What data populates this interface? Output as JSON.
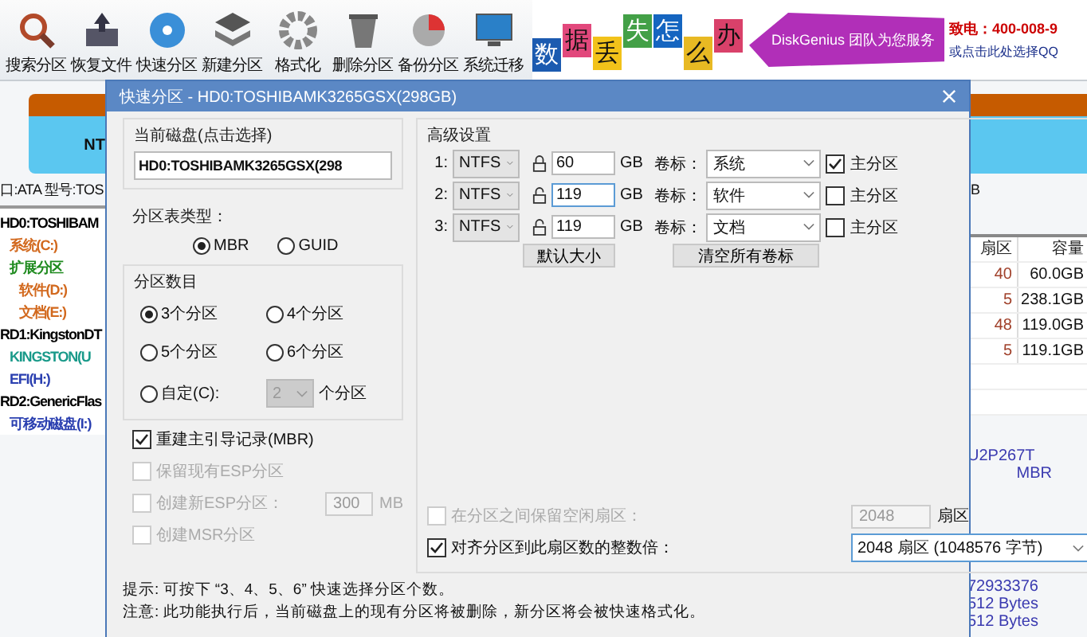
{
  "toolbar": [
    {
      "label": "搜索分区"
    },
    {
      "label": "恢复文件"
    },
    {
      "label": "快速分区"
    },
    {
      "label": "新建分区"
    },
    {
      "label": "格式化"
    },
    {
      "label": "删除分区"
    },
    {
      "label": "备份分区"
    },
    {
      "label": "系统迁移"
    }
  ],
  "banner": {
    "tiles": [
      {
        "text": "数",
        "color": "#1c5bb0"
      },
      {
        "text": "据",
        "color": "#e2487c"
      },
      {
        "text": "丢",
        "color": "#f2c21a"
      },
      {
        "text": "失",
        "color": "#43a047"
      },
      {
        "text": "怎",
        "color": "#1565c0"
      },
      {
        "text": "么",
        "color": "#e8b923"
      },
      {
        "text": "办",
        "color": "#d9416a"
      }
    ],
    "slogan": "DiskGenius 团队为您服务",
    "phone": "致电：400-008-9",
    "qq": "或点击此处选择QQ"
  },
  "disk_map": {
    "label": "NT"
  },
  "disk_info": {
    "left": "口:ATA  型号:TOS",
    "right": "B"
  },
  "tree": [
    {
      "label": "HD0:TOSHIBAM",
      "color": "#000000",
      "children": [
        {
          "label": "系统(C:)",
          "color": "#d2691e"
        },
        {
          "label": "扩展分区",
          "color": "#1e8a1e",
          "children": [
            {
              "label": "软件(D:)",
              "color": "#d2691e"
            },
            {
              "label": "文档(E:)",
              "color": "#d2691e"
            }
          ]
        }
      ]
    },
    {
      "label": "RD1:KingstonDT",
      "color": "#000000",
      "children": [
        {
          "label": "KINGSTON(U",
          "color": "#1a9a8a"
        },
        {
          "label": "EFI(H:)",
          "color": "#2a3fb0"
        }
      ]
    },
    {
      "label": "RD2:GenericFlas",
      "color": "#000000",
      "children": [
        {
          "label": "可移动磁盘(I:)",
          "color": "#2a3fb0"
        }
      ]
    }
  ],
  "table": {
    "columns": [
      "扇区",
      "容量"
    ],
    "rows": [
      [
        "40",
        "60.0GB"
      ],
      [
        "5",
        "238.1GB"
      ],
      [
        "48",
        "119.0GB"
      ],
      [
        "5",
        "119.1GB"
      ]
    ]
  },
  "details": [
    "U2P267T",
    "MBR",
    "72933376",
    "512 Bytes",
    "512 Bytes"
  ],
  "dialog": {
    "title": "快速分区 - HD0:TOSHIBAMK3265GSX(298GB)",
    "current_disk": {
      "label": "当前磁盘(点击选择)",
      "value": "HD0:TOSHIBAMK3265GSX(298"
    },
    "table_type": {
      "label": "分区表类型：",
      "options": [
        {
          "label": "MBR",
          "selected": true
        },
        {
          "label": "GUID",
          "selected": false
        }
      ]
    },
    "count": {
      "label": "分区数目",
      "options": [
        {
          "label": "3个分区",
          "selected": true
        },
        {
          "label": "4个分区",
          "selected": false
        },
        {
          "label": "5个分区",
          "selected": false
        },
        {
          "label": "6个分区",
          "selected": false
        },
        {
          "label": "自定(C):",
          "selected": false
        }
      ],
      "custom_value": "2",
      "custom_suffix": "个分区"
    },
    "options": [
      {
        "label": "重建主引导记录(MBR)",
        "checked": true,
        "disabled": false
      },
      {
        "label": "保留现有ESP分区",
        "checked": false,
        "disabled": true
      },
      {
        "label": "创建新ESP分区：",
        "checked": false,
        "disabled": true,
        "value": "300",
        "unit": "MB"
      },
      {
        "label": "创建MSR分区",
        "checked": false,
        "disabled": true
      }
    ],
    "advanced": {
      "label": "高级设置",
      "rows": [
        {
          "index": "1:",
          "fs": "NTFS",
          "locked": true,
          "size": "60",
          "unit": "GB",
          "vol_label": "卷标：",
          "volume": "系统",
          "primary_label": "主分区",
          "primary": true
        },
        {
          "index": "2:",
          "fs": "NTFS",
          "locked": false,
          "size": "119",
          "unit": "GB",
          "vol_label": "卷标：",
          "volume": "软件",
          "primary_label": "主分区",
          "primary": false
        },
        {
          "index": "3:",
          "fs": "NTFS",
          "locked": false,
          "size": "119",
          "unit": "GB",
          "vol_label": "卷标：",
          "volume": "文档",
          "primary_label": "主分区",
          "primary": false
        }
      ],
      "buttons": [
        "默认大小",
        "清空所有卷标"
      ]
    },
    "gap": {
      "label": "在分区之间保留空闲扇区：",
      "checked": false,
      "disabled": true,
      "value": "2048",
      "unit": "扇区"
    },
    "align": {
      "label": "对齐分区到此扇区数的整数倍：",
      "checked": true,
      "disabled": false,
      "value": "2048 扇区 (1048576 字节)"
    },
    "notes": [
      "提示: 可按下 “3、4、5、6” 快速选择分区个数。",
      "注意: 此功能执行后，当前磁盘上的现有分区将被删除，新分区将会被快速格式化。"
    ]
  }
}
